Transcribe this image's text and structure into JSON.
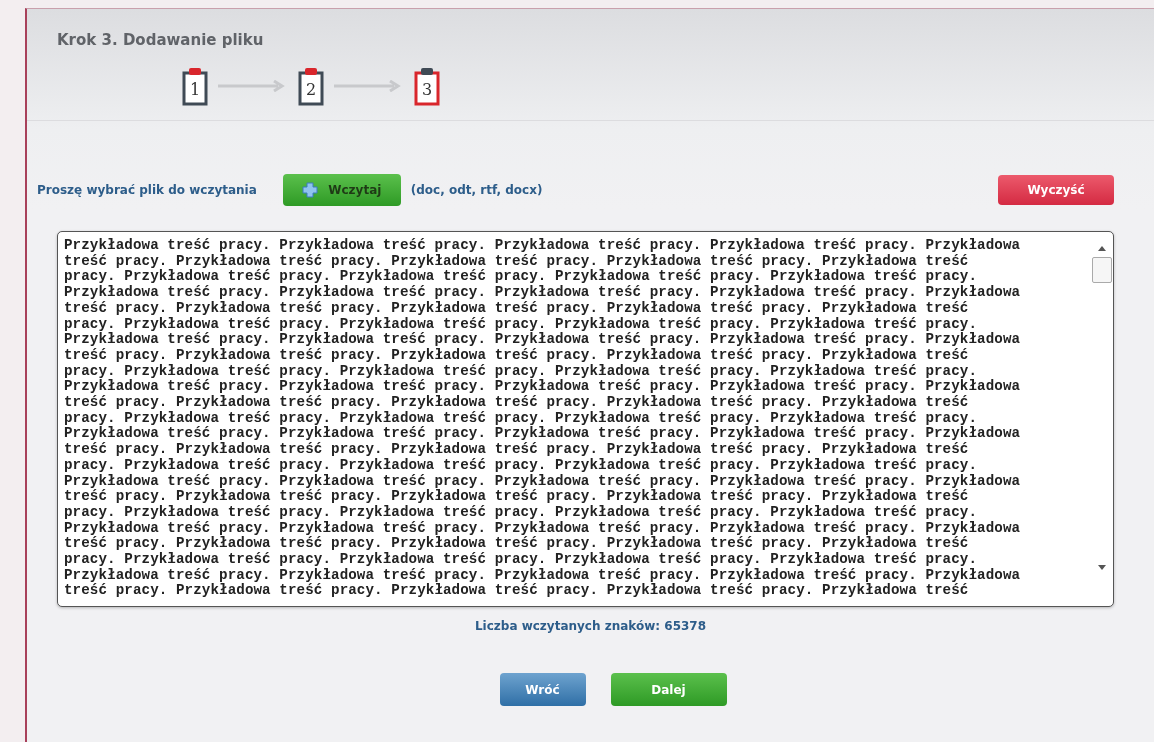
{
  "header": {
    "title": "Krok 3. Dodawanie pliku"
  },
  "steps": [
    {
      "label": "1",
      "current": false
    },
    {
      "label": "2",
      "current": false
    },
    {
      "label": "3",
      "current": true
    }
  ],
  "upload": {
    "prompt": "Proszę wybrać plik do wczytania",
    "button": "Wczytaj",
    "formats": "(doc, odt, rtf, docx)",
    "clear_button": "Wyczyść"
  },
  "editor": {
    "lines": [
      "Przykładowa treść pracy. Przykładowa treść pracy. Przykładowa treść pracy. Przykładowa treść pracy. Przykładowa",
      "treść pracy. Przykładowa treść pracy. Przykładowa treść pracy. Przykładowa treść pracy. Przykładowa treść",
      "pracy. Przykładowa treść pracy. Przykładowa treść pracy. Przykładowa treść pracy. Przykładowa treść pracy.",
      "Przykładowa treść pracy. Przykładowa treść pracy. Przykładowa treść pracy. Przykładowa treść pracy. Przykładowa",
      "treść pracy. Przykładowa treść pracy. Przykładowa treść pracy. Przykładowa treść pracy. Przykładowa treść",
      "pracy. Przykładowa treść pracy. Przykładowa treść pracy. Przykładowa treść pracy. Przykładowa treść pracy.",
      "Przykładowa treść pracy. Przykładowa treść pracy. Przykładowa treść pracy. Przykładowa treść pracy. Przykładowa",
      "treść pracy. Przykładowa treść pracy. Przykładowa treść pracy. Przykładowa treść pracy. Przykładowa treść",
      "pracy. Przykładowa treść pracy. Przykładowa treść pracy. Przykładowa treść pracy. Przykładowa treść pracy.",
      "Przykładowa treść pracy. Przykładowa treść pracy. Przykładowa treść pracy. Przykładowa treść pracy. Przykładowa",
      "treść pracy. Przykładowa treść pracy. Przykładowa treść pracy. Przykładowa treść pracy. Przykładowa treść",
      "pracy. Przykładowa treść pracy. Przykładowa treść pracy. Przykładowa treść pracy. Przykładowa treść pracy.",
      "Przykładowa treść pracy. Przykładowa treść pracy. Przykładowa treść pracy. Przykładowa treść pracy. Przykładowa",
      "treść pracy. Przykładowa treść pracy. Przykładowa treść pracy. Przykładowa treść pracy. Przykładowa treść",
      "pracy. Przykładowa treść pracy. Przykładowa treść pracy. Przykładowa treść pracy. Przykładowa treść pracy.",
      "Przykładowa treść pracy. Przykładowa treść pracy. Przykładowa treść pracy. Przykładowa treść pracy. Przykładowa",
      "treść pracy. Przykładowa treść pracy. Przykładowa treść pracy. Przykładowa treść pracy. Przykładowa treść",
      "pracy. Przykładowa treść pracy. Przykładowa treść pracy. Przykładowa treść pracy. Przykładowa treść pracy.",
      "Przykładowa treść pracy. Przykładowa treść pracy. Przykładowa treść pracy. Przykładowa treść pracy. Przykładowa",
      "treść pracy. Przykładowa treść pracy. Przykładowa treść pracy. Przykładowa treść pracy. Przykładowa treść",
      "pracy. Przykładowa treść pracy. Przykładowa treść pracy. Przykładowa treść pracy. Przykładowa treść pracy.",
      "Przykładowa treść pracy. Przykładowa treść pracy. Przykładowa treść pracy. Przykładowa treść pracy. Przykładowa",
      "treść pracy. Przykładowa treść pracy. Przykładowa treść pracy. Przykładowa treść pracy. Przykładowa treść"
    ]
  },
  "counter": "Liczba wczytanych znaków: 65378",
  "buttons": [
    {
      "kind": "back",
      "label": "Wróć"
    },
    {
      "kind": "next",
      "label": "Dalej"
    }
  ]
}
